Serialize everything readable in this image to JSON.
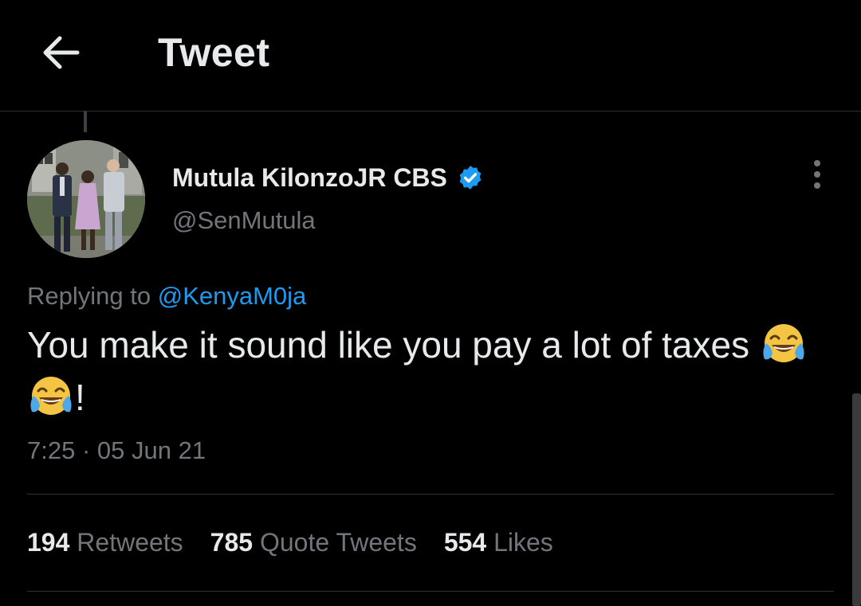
{
  "header": {
    "title": "Tweet",
    "back_icon": "arrow-left-icon"
  },
  "tweet": {
    "author": {
      "display_name": "Mutula KilonzoJR CBS",
      "handle": "@SenMutula",
      "verified": true
    },
    "replying_prefix": "Replying to",
    "replying_to": "@KenyaM0ja",
    "text_main": "You make it sound like you pay a lot of taxes",
    "text_end": "!",
    "emojis": [
      "face-with-tears-of-joy",
      "face-with-tears-of-joy"
    ],
    "time": "7:25",
    "separator": "·",
    "date": "05 Jun 21"
  },
  "stats": [
    {
      "count": "194",
      "label": "Retweets"
    },
    {
      "count": "785",
      "label": "Quote Tweets"
    },
    {
      "count": "554",
      "label": "Likes"
    }
  ],
  "colors": {
    "background": "#000000",
    "text_primary": "#e7e9ea",
    "text_secondary": "#71767b",
    "accent": "#1d9bf0",
    "border": "#2f3336"
  }
}
